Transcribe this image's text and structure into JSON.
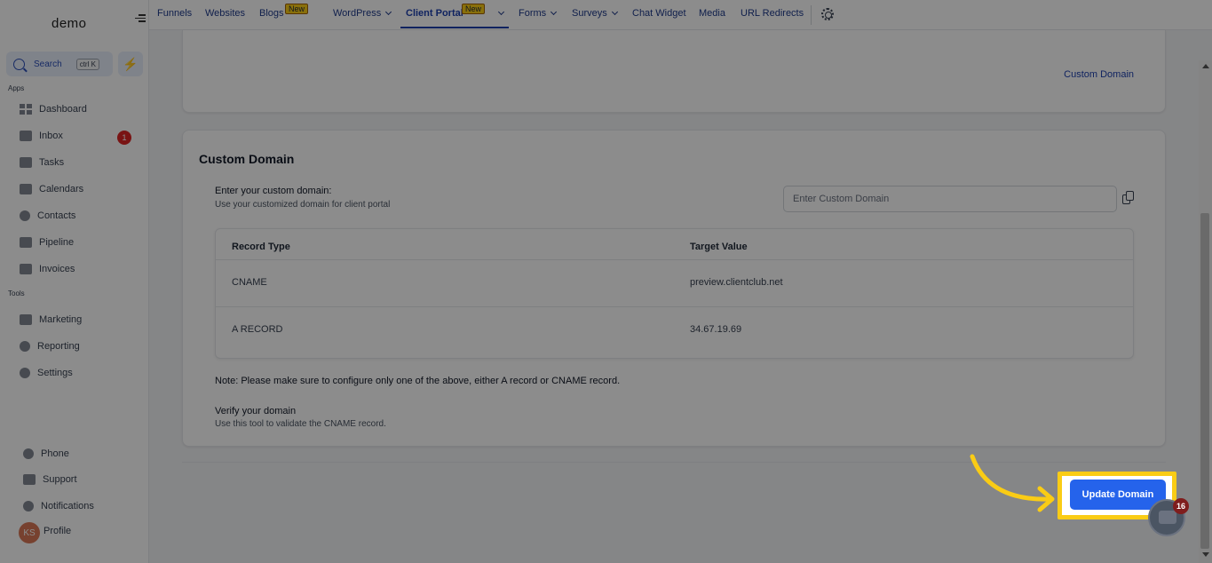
{
  "sidebar": {
    "logo": "demo",
    "search": {
      "label": "Search",
      "shortcut": "ctrl K"
    },
    "apps_label": "Apps",
    "tools_label": "Tools",
    "apps": [
      {
        "label": "Dashboard"
      },
      {
        "label": "Inbox",
        "badge": "1"
      },
      {
        "label": "Tasks"
      },
      {
        "label": "Calendars"
      },
      {
        "label": "Contacts"
      },
      {
        "label": "Pipeline"
      },
      {
        "label": "Invoices"
      }
    ],
    "tools": [
      {
        "label": "Marketing"
      },
      {
        "label": "Reporting"
      },
      {
        "label": "Settings"
      }
    ],
    "bottom": [
      {
        "label": "Phone"
      },
      {
        "label": "Support"
      },
      {
        "label": "Notifications"
      },
      {
        "label": "Profile"
      }
    ],
    "avatar_initials": "KS"
  },
  "topnav": {
    "items": [
      {
        "label": "Funnels"
      },
      {
        "label": "Websites"
      },
      {
        "label": "Blogs",
        "badge": "New"
      },
      {
        "label": "WordPress"
      },
      {
        "label": "Client Portal",
        "badge": "New",
        "active": true
      },
      {
        "label": "Forms"
      },
      {
        "label": "Surveys"
      },
      {
        "label": "Chat Widget"
      },
      {
        "label": "Media"
      },
      {
        "label": "URL Redirects"
      }
    ]
  },
  "top_card": {
    "link": "Custom Domain"
  },
  "custom_domain": {
    "title": "Custom Domain",
    "field_label": "Enter your custom domain:",
    "field_help": "Use your customized domain for client portal",
    "input_placeholder": "Enter Custom Domain",
    "table": {
      "headers": [
        "Record Type",
        "Target Value"
      ],
      "rows": [
        [
          "CNAME",
          "preview.clientclub.net"
        ],
        [
          "A RECORD",
          "34.67.19.69"
        ]
      ]
    },
    "note": "Note: Please make sure to configure only one of the above, either A record or CNAME record.",
    "verify_title": "Verify your domain",
    "verify_help": "Use this tool to validate the CNAME record."
  },
  "update_button": "Update Domain",
  "chat_badge": "16",
  "colors": {
    "primary": "#2563eb",
    "highlight": "#facc15",
    "badge": "#dc2626"
  }
}
